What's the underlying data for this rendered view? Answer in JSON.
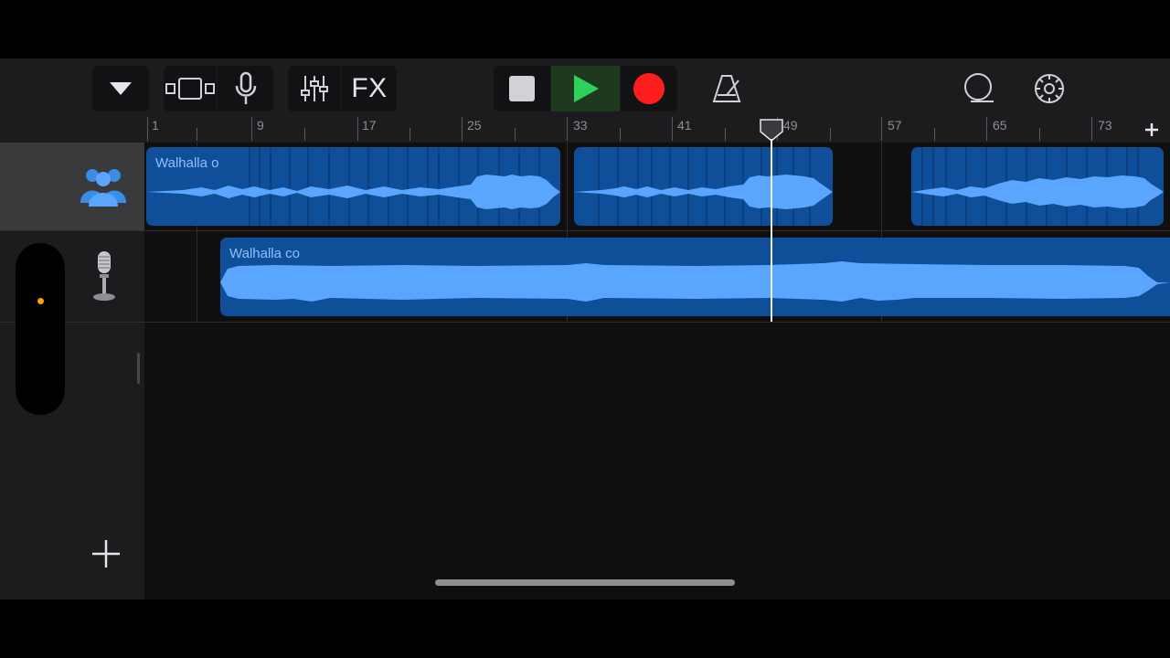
{
  "colors": {
    "region_fill": "#0f4e99",
    "waveform": "#5aa6ff",
    "region_label": "#8fc0ff",
    "play_active": "#2fd158",
    "record": "#ff1e1e",
    "toolbar_bg": "#1c1c1e"
  },
  "toolbar": {
    "icons": [
      "chevron-down-icon",
      "track-view-icon",
      "microphone-icon",
      "mixer-icon",
      "stop-icon",
      "play-icon",
      "record-icon",
      "metronome-icon",
      "loop-browser-icon",
      "settings-gear-icon"
    ],
    "fx_label": "FX"
  },
  "ruler": {
    "bar_labels": [
      "1",
      "9",
      "17",
      "25",
      "33",
      "41",
      "49",
      "57",
      "65",
      "73"
    ],
    "add_section_icon": "plus-icon"
  },
  "tracks": [
    {
      "instrument_icon": "drummer-group-icon",
      "selected": true,
      "regions": [
        {
          "label": "Walhalla o"
        },
        {
          "label": ""
        },
        {
          "label": ""
        }
      ]
    },
    {
      "instrument_icon": "studio-microphone-icon",
      "selected": false,
      "regions": [
        {
          "label": "Walhalla co"
        }
      ]
    }
  ],
  "track_controls": {
    "add_track_icon": "plus-icon",
    "volume_indicator_color": "#ff9f0a"
  },
  "playhead": {
    "bar": 48
  }
}
